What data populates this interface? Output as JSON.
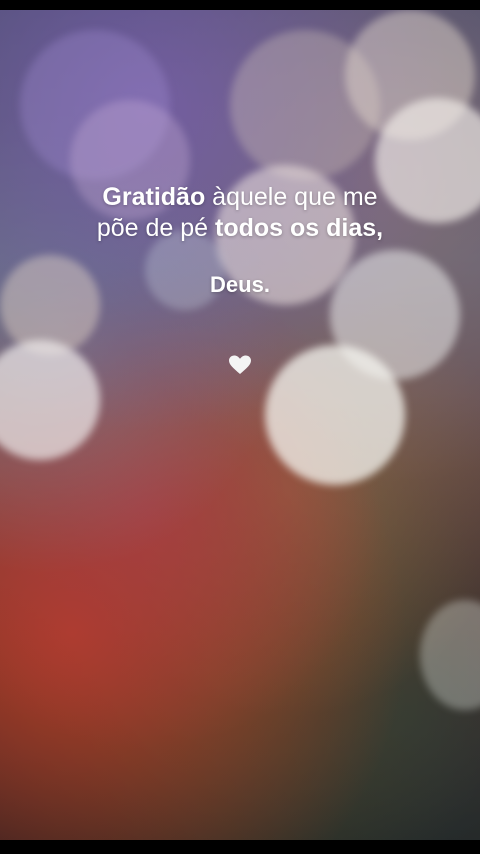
{
  "quote": {
    "line1_bold": "Gratidão",
    "line1_light": " àquele que me",
    "line2_light": "põe de pé ",
    "line2_bold": "todos os dias,"
  },
  "signature": "Deus.",
  "icons": {
    "heart": "heart-icon"
  },
  "colors": {
    "text": "#ffffff",
    "heart": "#f4f4f4"
  }
}
